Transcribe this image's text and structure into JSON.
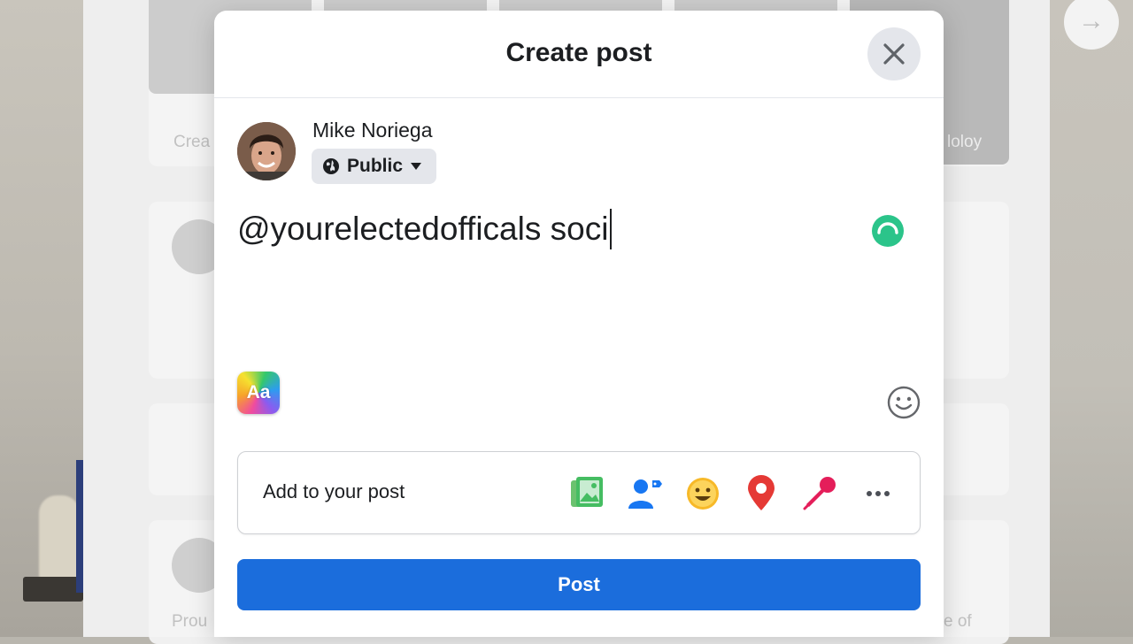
{
  "dialog": {
    "title": "Create post",
    "close_icon": "close-icon"
  },
  "author": {
    "name": "Mike Noriega",
    "audience": "Public",
    "audience_icon": "globe-icon"
  },
  "composer": {
    "text": "@yourelectedofficals soci",
    "grammar_icon": "loading-icon",
    "text_style_label": "Aa"
  },
  "add_to_post": {
    "label": "Add to your post",
    "icons": [
      "photo-video-icon",
      "tag-people-icon",
      "feeling-icon",
      "check-in-icon",
      "live-audio-icon",
      "more-icon"
    ]
  },
  "post_button": "Post",
  "background": {
    "story_labels": [
      "Crea",
      "loloy"
    ],
    "feed_fragments": [
      "Prou",
      "e of"
    ]
  },
  "colors": {
    "primary": "#1b6ddc",
    "gray_button": "#e4e6eb",
    "grammar_green": "#2bc48a"
  }
}
